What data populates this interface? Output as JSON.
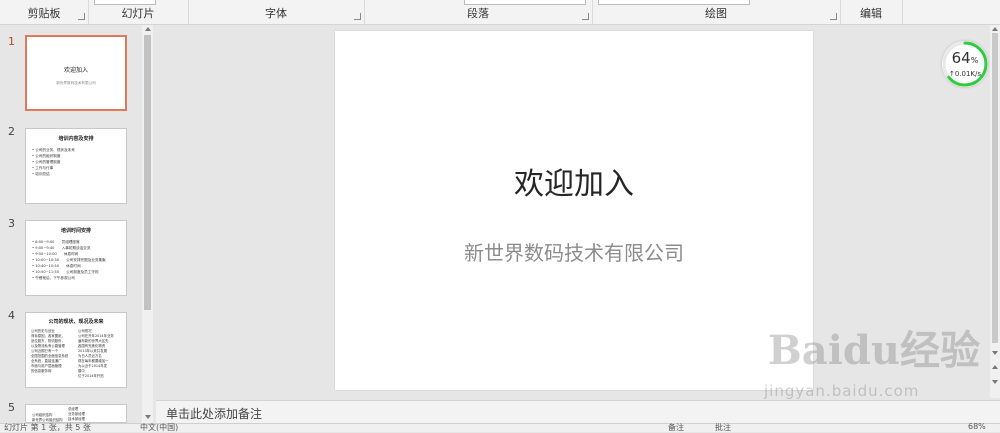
{
  "ribbon": {
    "groups": [
      {
        "label": "剪贴板"
      },
      {
        "label": "幻灯片"
      },
      {
        "label": "字体"
      },
      {
        "label": "段落"
      },
      {
        "label": "绘图"
      },
      {
        "label": "编辑"
      }
    ]
  },
  "thumbnails": [
    {
      "num": "1",
      "title": "欢迎加入",
      "subtitle": "新世界数码技术有限公司"
    },
    {
      "num": "2",
      "title": "培训内容及安排",
      "bullets": [
        "公司的业务、现状及未来",
        "公司的组织制度",
        "公司的管理制度",
        "工作与行事",
        "培训总结"
      ]
    },
    {
      "num": "3",
      "title": "培训时间安排",
      "bullets": [
        "8:00~9:00　　员组理座席",
        "9:00~9:40　　入事初期谈话交流",
        "9:50~10:00　　休息时间",
        "10:00~10:30　　公司安排完图及业务集聚",
        "10:40~10:50　　休息时间",
        "10:50~11:50　　公司制度及员工守则",
        "午餐就后，下午参观公司"
      ]
    },
    {
      "num": "4",
      "title": "公司的现状、现况及未来",
      "left": [
        "公司历史与创业",
        "商标原因，各家图纸，",
        "品位股东，物流股份，",
        "以及物流私有公路管理",
        "公司近期已有一个",
        "全国范围的全面信息系统",
        "全系统，直接连通广",
        "市面与用户层面管理",
        "的信息服务网"
      ],
      "right": [
        "公司现况",
        "公司在开年2014年业务",
        "遍布新的世界大区先",
        "各国有完美化物资",
        "2013年以来共发展",
        "为日人员近万名",
        "现在每年都要增加一",
        "为以近于2014年发",
        "展中",
        "位于2014年开拓"
      ]
    },
    {
      "num": "5",
      "left": [
        "公司组织结构",
        "新世界公司组织结构"
      ],
      "right": [
        "总经理",
        "业务部经理",
        "技术部经理"
      ]
    }
  ],
  "slide": {
    "title": "欢迎加入",
    "subtitle": "新世界数码技术有限公司"
  },
  "notes": {
    "placeholder": "单击此处添加备注"
  },
  "speed_widget": {
    "percent": "64",
    "unit": "%",
    "rate": "↑0.01K/s",
    "color": "#2ecc40"
  },
  "status_bar": {
    "left": "幻灯片 第 1 张，共 5 张",
    "lang": "中文(中国)",
    "notes": "备注",
    "comments": "批注",
    "zoom": "68%"
  },
  "watermark": {
    "brand": "Baidu经验",
    "url": "jingyan.baidu.com"
  }
}
